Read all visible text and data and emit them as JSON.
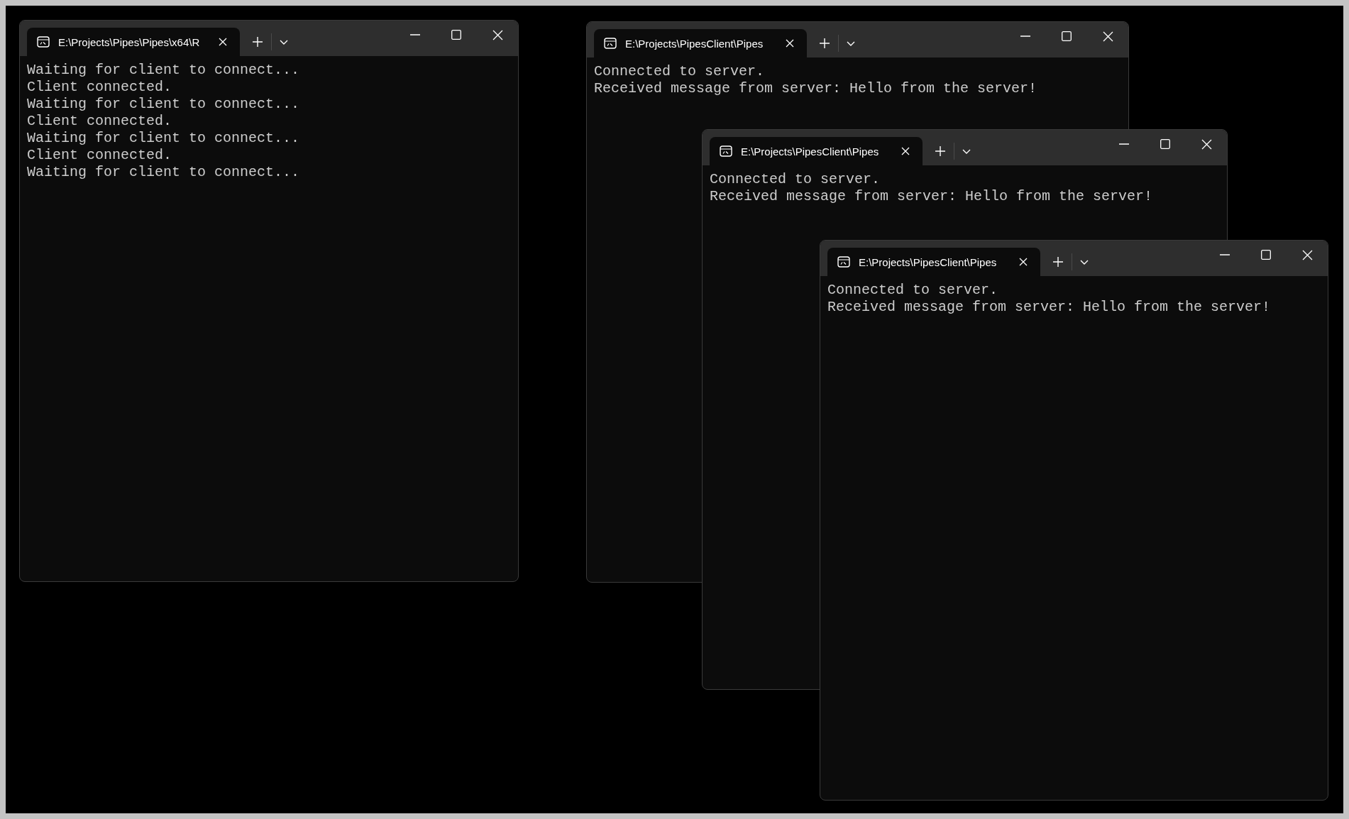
{
  "windows": [
    {
      "tab_title": "E:\\Projects\\Pipes\\Pipes\\x64\\R",
      "lines": [
        "Waiting for client to connect...",
        "Client connected.",
        "Waiting for client to connect...",
        "Client connected.",
        "Waiting for client to connect...",
        "Client connected.",
        "Waiting for client to connect..."
      ]
    },
    {
      "tab_title": "E:\\Projects\\PipesClient\\Pipes",
      "lines": [
        "Connected to server.",
        "Received message from server: Hello from the server!"
      ]
    },
    {
      "tab_title": "E:\\Projects\\PipesClient\\Pipes",
      "lines": [
        "Connected to server.",
        "Received message from server: Hello from the server!"
      ]
    },
    {
      "tab_title": "E:\\Projects\\PipesClient\\Pipes",
      "lines": [
        "Connected to server.",
        "Received message from server: Hello from the server!"
      ]
    }
  ]
}
